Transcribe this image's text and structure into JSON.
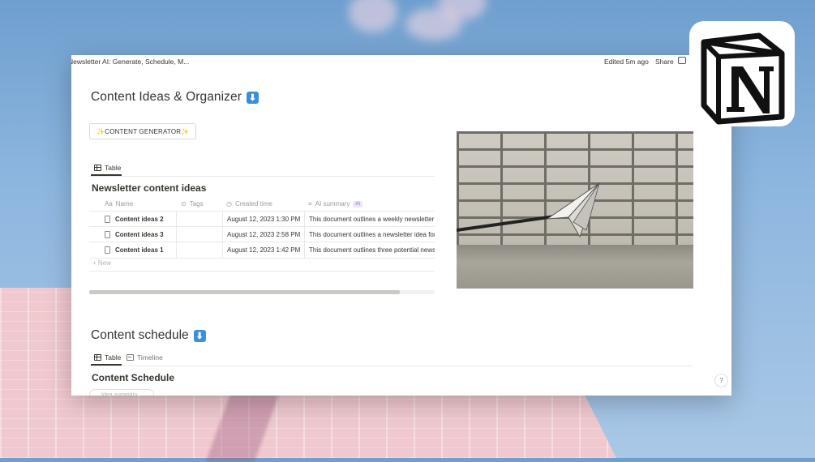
{
  "topbar": {
    "breadcrumb": "Newsletter AI: Generate, Schedule, M...",
    "edited": "Edited 5m ago",
    "share_label": "Share"
  },
  "page": {
    "title": "Content Ideas & Organizer",
    "generator_button": "✨CONTENT GENERATOR✨"
  },
  "ideas_db": {
    "view_tab": "Table",
    "title": "Newsletter content ideas",
    "columns": {
      "name": "Name",
      "tags": "Tags",
      "created": "Created time",
      "summary": "AI summary",
      "ai_badge": "AI"
    },
    "rows": [
      {
        "name": "Content ideas 2",
        "tags": "",
        "created": "August 12, 2023 1:30 PM",
        "summary": "This document outlines a weekly newsletter f"
      },
      {
        "name": "Content ideas 3",
        "tags": "",
        "created": "August 12, 2023 2:58 PM",
        "summary": "This document outlines a newsletter idea for"
      },
      {
        "name": "Content ideas 1",
        "tags": "",
        "created": "August 12, 2023 1:42 PM",
        "summary": "This document outlines three potential newsl"
      }
    ],
    "new_label": "New",
    "scroll_fraction": 0.9
  },
  "schedule": {
    "title": "Content schedule",
    "tabs": [
      "Table",
      "Timeline"
    ],
    "db_title": "Content Schedule",
    "search_placeholder": "Idea summary"
  },
  "help_label": "?",
  "colors": {
    "accent_blue": "#3b8fd6",
    "text": "#37352f",
    "muted": "#9b9a97"
  },
  "icons": [
    "table-icon",
    "timeline-icon",
    "document-icon",
    "arrow-down-icon",
    "notion-logo",
    "help-icon"
  ]
}
